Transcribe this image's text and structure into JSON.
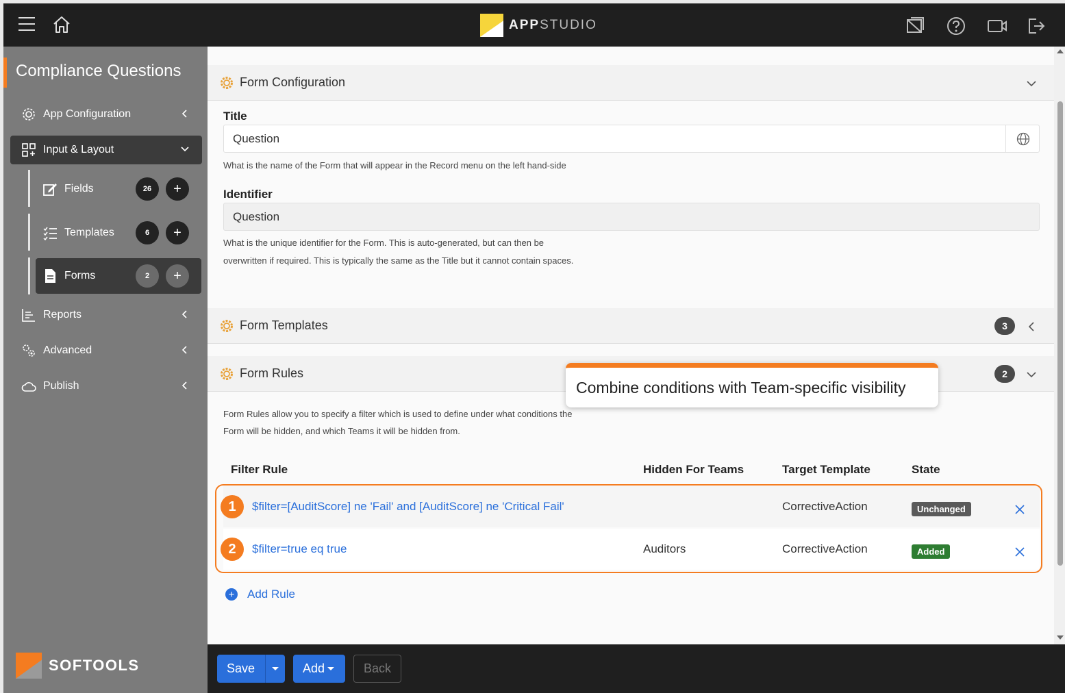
{
  "header": {
    "logo_bold": "APP",
    "logo_light": "STUDIO",
    "icons": [
      "menu-icon",
      "home-icon",
      "disable-view-icon",
      "help-icon",
      "video-icon",
      "logout-icon"
    ]
  },
  "sidebar": {
    "title": "Compliance Questions",
    "items": [
      {
        "label": "App Configuration",
        "icon": "gear-icon"
      },
      {
        "label": "Input & Layout",
        "icon": "grid-icon",
        "expanded": true
      },
      {
        "label": "Reports",
        "icon": "report-icon"
      },
      {
        "label": "Advanced",
        "icon": "gears-icon"
      },
      {
        "label": "Publish",
        "icon": "cloud-icon"
      }
    ],
    "children": [
      {
        "label": "Fields",
        "count": "26",
        "icon": "edit-icon"
      },
      {
        "label": "Templates",
        "count": "6",
        "icon": "list-icon"
      },
      {
        "label": "Forms",
        "count": "2",
        "icon": "document-icon",
        "active": true
      }
    ],
    "brand": "SOFTOOLS"
  },
  "form_config": {
    "heading": "Form Configuration",
    "title_label": "Title",
    "title_value": "Question",
    "title_help": "What is the name of the Form that will appear in the Record menu on the left hand-side",
    "identifier_label": "Identifier",
    "identifier_value": "Question",
    "identifier_help_1": "What is the unique identifier for the Form. This is auto-generated, but can then be",
    "identifier_help_2": "overwritten if required. This is typically the same as the Title but it cannot contain spaces."
  },
  "form_templates": {
    "heading": "Form Templates",
    "count": "3"
  },
  "form_rules": {
    "heading": "Form Rules",
    "count": "2",
    "help_1": "Form Rules allow you to specify a filter which is used to define under what conditions the",
    "help_2": "Form will be hidden, and which Teams it will be hidden from.",
    "columns": [
      "Filter Rule",
      "Hidden For Teams",
      "Target Template",
      "State"
    ],
    "rows": [
      {
        "num": "1",
        "rule": "$filter=[AuditScore] ne 'Fail' and [AuditScore] ne 'Critical Fail'",
        "teams": "",
        "template": "CorrectiveAction",
        "state": "Unchanged",
        "state_color": "#5a5a5a"
      },
      {
        "num": "2",
        "rule": "$filter=true eq true",
        "teams": "Auditors",
        "template": "CorrectiveAction",
        "state": "Added",
        "state_color": "#2e7d32"
      }
    ],
    "add_rule": "Add Rule"
  },
  "callout": "Combine conditions with Team-specific visibility",
  "footer": {
    "save": "Save",
    "add": "Add",
    "back": "Back"
  },
  "colors": {
    "accent": "#f47c20",
    "primary": "#2a6fdb",
    "topbar": "#1f1f1f",
    "sidebar": "#7b7b7b"
  }
}
